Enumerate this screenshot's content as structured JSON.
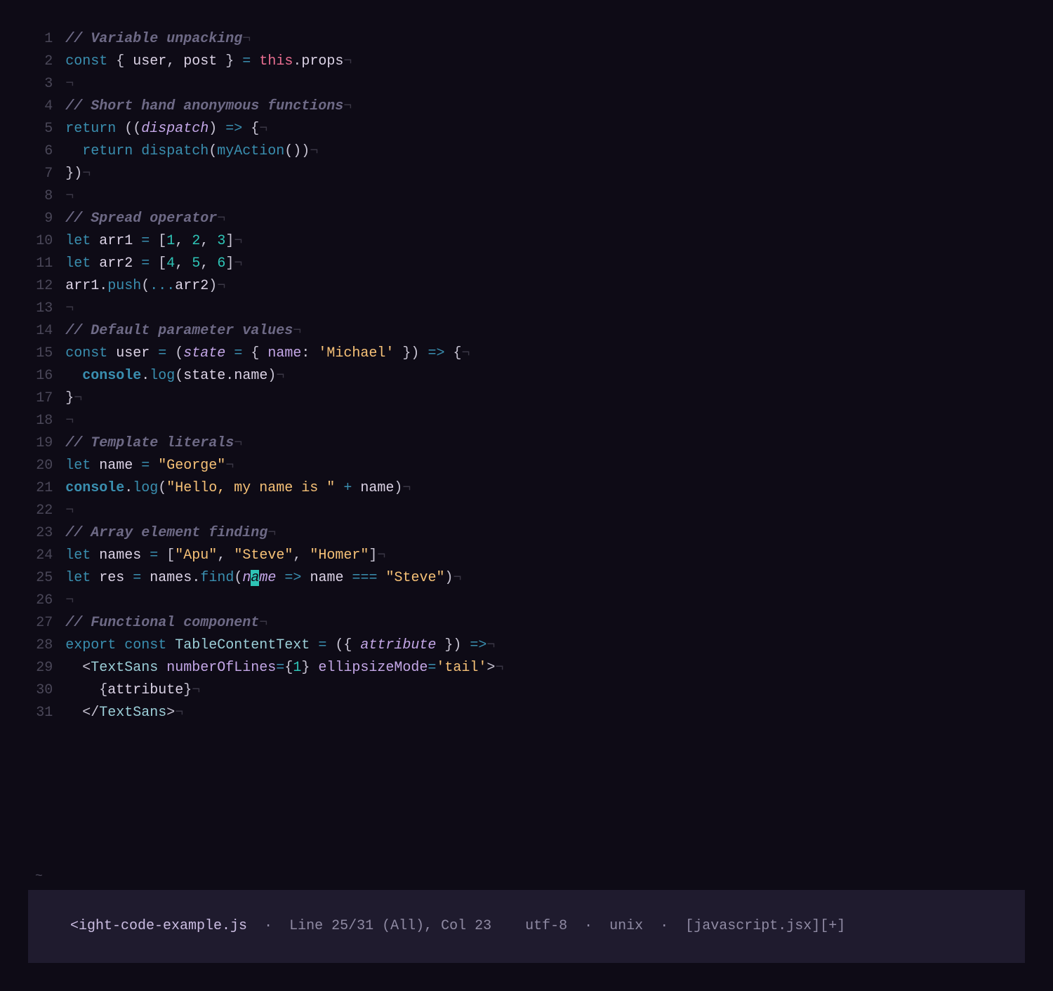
{
  "colors": {
    "background": "#0e0b16",
    "gutter": "#4a4758",
    "comment": "#6e6a86",
    "keyword": "#3a8fb0",
    "string": "#f6c177",
    "number": "#2ec4b6",
    "param": "#c4a7e7",
    "jsxtag": "#9ccfd8",
    "this": "#eb6f92",
    "cursor_bg": "#2ec4b6"
  },
  "editor": {
    "whitespace_marker": "¬",
    "cursor": {
      "line": 25,
      "col": 23,
      "char": "a"
    },
    "lines": [
      {
        "n": 1,
        "tokens": [
          [
            "comment",
            "// Variable unpacking"
          ]
        ]
      },
      {
        "n": 2,
        "tokens": [
          [
            "storage",
            "const"
          ],
          [
            "punct",
            " { "
          ],
          [
            "ident",
            "user"
          ],
          [
            "punct",
            ", "
          ],
          [
            "ident",
            "post"
          ],
          [
            "punct",
            " } "
          ],
          [
            "operator",
            "="
          ],
          [
            "punct",
            " "
          ],
          [
            "this",
            "this"
          ],
          [
            "punct",
            "."
          ],
          [
            "ident",
            "props"
          ]
        ]
      },
      {
        "n": 3,
        "tokens": []
      },
      {
        "n": 4,
        "tokens": [
          [
            "comment",
            "// Short hand anonymous functions"
          ]
        ]
      },
      {
        "n": 5,
        "tokens": [
          [
            "keyword",
            "return"
          ],
          [
            "punct",
            " (("
          ],
          [
            "param",
            "dispatch"
          ],
          [
            "punct",
            ") "
          ],
          [
            "operator",
            "=>"
          ],
          [
            "punct",
            " {"
          ]
        ]
      },
      {
        "n": 6,
        "indent": 2,
        "tokens": [
          [
            "keyword",
            "return"
          ],
          [
            "punct",
            " "
          ],
          [
            "func",
            "dispatch"
          ],
          [
            "punct",
            "("
          ],
          [
            "func",
            "myAction"
          ],
          [
            "punct",
            "())"
          ]
        ]
      },
      {
        "n": 7,
        "tokens": [
          [
            "punct",
            "})"
          ]
        ]
      },
      {
        "n": 8,
        "tokens": []
      },
      {
        "n": 9,
        "tokens": [
          [
            "comment",
            "// Spread operator"
          ]
        ]
      },
      {
        "n": 10,
        "tokens": [
          [
            "storage",
            "let"
          ],
          [
            "punct",
            " "
          ],
          [
            "ident",
            "arr1"
          ],
          [
            "punct",
            " "
          ],
          [
            "operator",
            "="
          ],
          [
            "punct",
            " ["
          ],
          [
            "number",
            "1"
          ],
          [
            "punct",
            ", "
          ],
          [
            "number",
            "2"
          ],
          [
            "punct",
            ", "
          ],
          [
            "number",
            "3"
          ],
          [
            "punct",
            "]"
          ]
        ]
      },
      {
        "n": 11,
        "tokens": [
          [
            "storage",
            "let"
          ],
          [
            "punct",
            " "
          ],
          [
            "ident",
            "arr2"
          ],
          [
            "punct",
            " "
          ],
          [
            "operator",
            "="
          ],
          [
            "punct",
            " ["
          ],
          [
            "number",
            "4"
          ],
          [
            "punct",
            ", "
          ],
          [
            "number",
            "5"
          ],
          [
            "punct",
            ", "
          ],
          [
            "number",
            "6"
          ],
          [
            "punct",
            "]"
          ]
        ]
      },
      {
        "n": 12,
        "tokens": [
          [
            "ident",
            "arr1"
          ],
          [
            "punct",
            "."
          ],
          [
            "method",
            "push"
          ],
          [
            "punct",
            "("
          ],
          [
            "operator",
            "..."
          ],
          [
            "ident",
            "arr2"
          ],
          [
            "punct",
            ")"
          ]
        ]
      },
      {
        "n": 13,
        "tokens": []
      },
      {
        "n": 14,
        "tokens": [
          [
            "comment",
            "// Default parameter values"
          ]
        ]
      },
      {
        "n": 15,
        "tokens": [
          [
            "storage",
            "const"
          ],
          [
            "punct",
            " "
          ],
          [
            "ident",
            "user"
          ],
          [
            "punct",
            " "
          ],
          [
            "operator",
            "="
          ],
          [
            "punct",
            " ("
          ],
          [
            "param",
            "state"
          ],
          [
            "punct",
            " "
          ],
          [
            "operator",
            "="
          ],
          [
            "punct",
            " { "
          ],
          [
            "propkey",
            "name"
          ],
          [
            "punct",
            ": "
          ],
          [
            "string",
            "'Michael'"
          ],
          [
            "punct",
            " }) "
          ],
          [
            "operator",
            "=>"
          ],
          [
            "punct",
            " {"
          ]
        ]
      },
      {
        "n": 16,
        "indent": 2,
        "tokens": [
          [
            "builtin",
            "console"
          ],
          [
            "punct",
            "."
          ],
          [
            "method",
            "log"
          ],
          [
            "punct",
            "("
          ],
          [
            "ident",
            "state"
          ],
          [
            "punct",
            "."
          ],
          [
            "ident",
            "name"
          ],
          [
            "punct",
            ")"
          ]
        ]
      },
      {
        "n": 17,
        "tokens": [
          [
            "punct",
            "}"
          ]
        ]
      },
      {
        "n": 18,
        "tokens": []
      },
      {
        "n": 19,
        "tokens": [
          [
            "comment",
            "// Template literals"
          ]
        ]
      },
      {
        "n": 20,
        "tokens": [
          [
            "storage",
            "let"
          ],
          [
            "punct",
            " "
          ],
          [
            "ident",
            "name"
          ],
          [
            "punct",
            " "
          ],
          [
            "operator",
            "="
          ],
          [
            "punct",
            " "
          ],
          [
            "string",
            "\"George\""
          ]
        ]
      },
      {
        "n": 21,
        "tokens": [
          [
            "builtin",
            "console"
          ],
          [
            "punct",
            "."
          ],
          [
            "method",
            "log"
          ],
          [
            "punct",
            "("
          ],
          [
            "string",
            "\"Hello, my name is \""
          ],
          [
            "punct",
            " "
          ],
          [
            "operator",
            "+"
          ],
          [
            "punct",
            " "
          ],
          [
            "ident",
            "name"
          ],
          [
            "punct",
            ")"
          ]
        ]
      },
      {
        "n": 22,
        "tokens": []
      },
      {
        "n": 23,
        "tokens": [
          [
            "comment",
            "// Array element finding"
          ]
        ]
      },
      {
        "n": 24,
        "tokens": [
          [
            "storage",
            "let"
          ],
          [
            "punct",
            " "
          ],
          [
            "ident",
            "names"
          ],
          [
            "punct",
            " "
          ],
          [
            "operator",
            "="
          ],
          [
            "punct",
            " ["
          ],
          [
            "string",
            "\"Apu\""
          ],
          [
            "punct",
            ", "
          ],
          [
            "string",
            "\"Steve\""
          ],
          [
            "punct",
            ", "
          ],
          [
            "string",
            "\"Homer\""
          ],
          [
            "punct",
            "]"
          ]
        ]
      },
      {
        "n": 25,
        "tokens": [
          [
            "storage",
            "let"
          ],
          [
            "punct",
            " "
          ],
          [
            "ident",
            "res"
          ],
          [
            "punct",
            " "
          ],
          [
            "operator",
            "="
          ],
          [
            "punct",
            " "
          ],
          [
            "ident",
            "names"
          ],
          [
            "punct",
            "."
          ],
          [
            "method",
            "find"
          ],
          [
            "punct",
            "("
          ],
          [
            "param",
            "n"
          ],
          [
            "cursor",
            "a"
          ],
          [
            "param",
            "me"
          ],
          [
            "punct",
            " "
          ],
          [
            "operator",
            "=>"
          ],
          [
            "punct",
            " "
          ],
          [
            "ident",
            "name"
          ],
          [
            "punct",
            " "
          ],
          [
            "operator",
            "==="
          ],
          [
            "punct",
            " "
          ],
          [
            "string",
            "\"Steve\""
          ],
          [
            "punct",
            ")"
          ]
        ]
      },
      {
        "n": 26,
        "tokens": []
      },
      {
        "n": 27,
        "tokens": [
          [
            "comment",
            "// Functional component"
          ]
        ]
      },
      {
        "n": 28,
        "tokens": [
          [
            "export",
            "export"
          ],
          [
            "punct",
            " "
          ],
          [
            "storage",
            "const"
          ],
          [
            "punct",
            " "
          ],
          [
            "type",
            "TableContentText"
          ],
          [
            "punct",
            " "
          ],
          [
            "operator",
            "="
          ],
          [
            "punct",
            " ({ "
          ],
          [
            "param",
            "attribute"
          ],
          [
            "punct",
            " }) "
          ],
          [
            "operator",
            "=>"
          ]
        ]
      },
      {
        "n": 29,
        "indent": 2,
        "tokens": [
          [
            "punct",
            "<"
          ],
          [
            "jsxtag",
            "TextSans"
          ],
          [
            "punct",
            " "
          ],
          [
            "jsxattr",
            "numberOfLines"
          ],
          [
            "operator",
            "="
          ],
          [
            "punct",
            "{"
          ],
          [
            "number",
            "1"
          ],
          [
            "punct",
            "} "
          ],
          [
            "jsxattr",
            "ellipsizeMode"
          ],
          [
            "operator",
            "="
          ],
          [
            "string",
            "'tail'"
          ],
          [
            "punct",
            ">"
          ]
        ]
      },
      {
        "n": 30,
        "indent": 4,
        "tokens": [
          [
            "punct",
            "{"
          ],
          [
            "ident",
            "attribute"
          ],
          [
            "punct",
            "}"
          ]
        ]
      },
      {
        "n": 31,
        "indent": 2,
        "tokens": [
          [
            "punct",
            "</"
          ],
          [
            "jsxtag",
            "TextSans"
          ],
          [
            "punct",
            ">"
          ]
        ]
      }
    ]
  },
  "statusbar": {
    "file": "<ight-code-example.js",
    "sep": "  ·  ",
    "position": "Line 25/31 (All), Col 23",
    "encoding": "utf-8",
    "fileformat": "unix",
    "filetype": "[javascript.jsx][+]"
  },
  "tilde": "~"
}
